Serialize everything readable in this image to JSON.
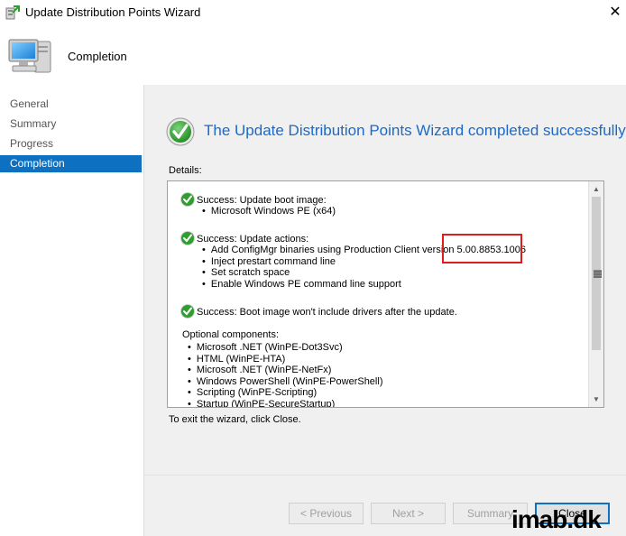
{
  "window": {
    "title": "Update Distribution Points Wizard",
    "close_glyph": "✕"
  },
  "header": {
    "title": "Completion",
    "icon": "computer-icon"
  },
  "nav": {
    "items": [
      {
        "label": "General",
        "active": false
      },
      {
        "label": "Summary",
        "active": false
      },
      {
        "label": "Progress",
        "active": false
      },
      {
        "label": "Completion",
        "active": true
      }
    ]
  },
  "main": {
    "headline": "The Update Distribution Points Wizard completed successfully",
    "details_label": "Details:",
    "entries": [
      {
        "title": "Success: Update boot image:",
        "bullets": [
          "Microsoft Windows PE (x64)"
        ]
      },
      {
        "title": "Success: Update actions:",
        "bullets": [
          "Add ConfigMgr binaries using Production Client version 5.00.8853.1006",
          "Inject prestart command line",
          "Set scratch space",
          "Enable Windows PE command line support"
        ]
      },
      {
        "title": "Success: Boot image won't include drivers after the update.",
        "bullets": []
      }
    ],
    "optional_label": "Optional components:",
    "optional_items": [
      "Microsoft .NET (WinPE-Dot3Svc)",
      "HTML (WinPE-HTA)",
      "Microsoft .NET (WinPE-NetFx)",
      "Windows PowerShell (WinPE-PowerShell)",
      "Scripting (WinPE-Scripting)",
      "Startup (WinPE-SecureStartup)"
    ],
    "highlight_version": "5.00.8853.1006",
    "exit_text": "To exit the wizard, click Close."
  },
  "buttons": {
    "previous": "< Previous",
    "next": "Next >",
    "summary": "Summary",
    "close": "Close"
  },
  "watermark": "imab.dk",
  "colors": {
    "accent": "#0e70c0",
    "headline": "#1b6ac9",
    "highlight": "#e21b1b",
    "success": "#2e9e2e"
  }
}
